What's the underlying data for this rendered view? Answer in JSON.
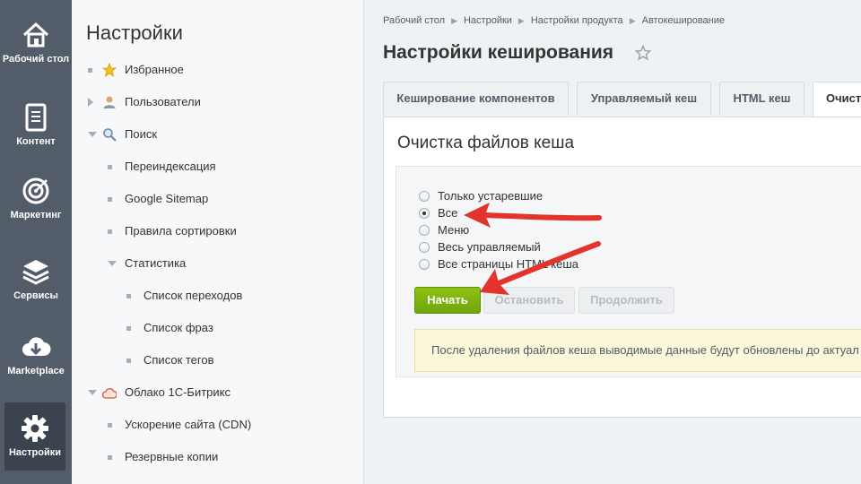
{
  "rail": {
    "items": [
      {
        "label": "Рабочий стол",
        "icon": "home-icon"
      },
      {
        "label": "Контент",
        "icon": "document-icon"
      },
      {
        "label": "Маркетинг",
        "icon": "target-icon"
      },
      {
        "label": "Сервисы",
        "icon": "layers-icon"
      },
      {
        "label": "Marketplace",
        "icon": "cloud-download-icon"
      },
      {
        "label": "Настройки",
        "icon": "gear-icon"
      }
    ]
  },
  "menu": {
    "title": "Настройки",
    "items": [
      {
        "label": "Избранное",
        "icon": "star-icon"
      },
      {
        "label": "Пользователи",
        "icon": "user-icon"
      },
      {
        "label": "Поиск",
        "icon": "search-icon"
      },
      {
        "label": "Переиндексация"
      },
      {
        "label": "Google Sitemap"
      },
      {
        "label": "Правила сортировки"
      },
      {
        "label": "Статистика"
      },
      {
        "label": "Список переходов"
      },
      {
        "label": "Список фраз"
      },
      {
        "label": "Список тегов"
      },
      {
        "label": "Облако 1С-Битрикс",
        "icon": "cloud-icon"
      },
      {
        "label": "Ускорение сайта (CDN)"
      },
      {
        "label": "Резервные копии"
      }
    ]
  },
  "breadcrumbs": [
    "Рабочий стол",
    "Настройки",
    "Настройки продукта",
    "Автокеширование"
  ],
  "page_title": "Настройки кеширования",
  "tabs": [
    "Кеширование компонентов",
    "Управляемый кеш",
    "HTML кеш",
    "Очист"
  ],
  "panel": {
    "title": "Очистка файлов кеша",
    "options": [
      {
        "label": "Только устаревшие",
        "checked": false
      },
      {
        "label": "Все",
        "checked": true
      },
      {
        "label": "Меню",
        "checked": false
      },
      {
        "label": "Весь управляемый",
        "checked": false
      },
      {
        "label": "Все страницы HTML кеша",
        "checked": false
      }
    ],
    "buttons": {
      "start": "Начать",
      "stop": "Остановить",
      "continue": "Продолжить"
    },
    "notice": "После удаления файлов кеша выводимые данные будут обновлены до актуал"
  },
  "colors": {
    "rail_bg": "#535c69",
    "start_button": "#7cb20f",
    "annotation_arrow": "#e2342c",
    "notice_bg": "#fbf7d9"
  }
}
